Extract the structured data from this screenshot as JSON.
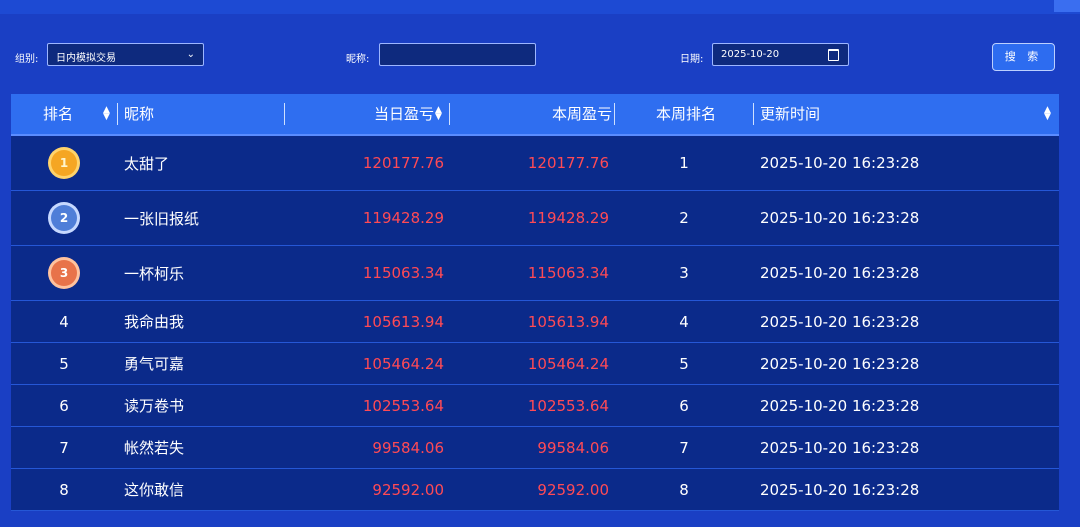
{
  "filters": {
    "group_label": "组别:",
    "group_value": "日内模拟交易",
    "nickname_label": "昵称:",
    "nickname_value": "",
    "date_label": "日期:",
    "date_value": "2025-10-20",
    "search_label": "搜 索"
  },
  "table": {
    "headers": {
      "rank": "排名",
      "name": "昵称",
      "day_pnl": "当日盈亏",
      "week_pnl": "本周盈亏",
      "week_rank": "本周排名",
      "updated": "更新时间"
    },
    "rows": [
      {
        "rank": "1",
        "name": "太甜了",
        "day_pnl": "120177.76",
        "week_pnl": "120177.76",
        "week_rank": "1",
        "updated": "2025-10-20 16:23:28"
      },
      {
        "rank": "2",
        "name": "一张旧报纸",
        "day_pnl": "119428.29",
        "week_pnl": "119428.29",
        "week_rank": "2",
        "updated": "2025-10-20 16:23:28"
      },
      {
        "rank": "3",
        "name": "一杯柯乐",
        "day_pnl": "115063.34",
        "week_pnl": "115063.34",
        "week_rank": "3",
        "updated": "2025-10-20 16:23:28"
      },
      {
        "rank": "4",
        "name": "我命由我",
        "day_pnl": "105613.94",
        "week_pnl": "105613.94",
        "week_rank": "4",
        "updated": "2025-10-20 16:23:28"
      },
      {
        "rank": "5",
        "name": "勇气可嘉",
        "day_pnl": "105464.24",
        "week_pnl": "105464.24",
        "week_rank": "5",
        "updated": "2025-10-20 16:23:28"
      },
      {
        "rank": "6",
        "name": "读万卷书",
        "day_pnl": "102553.64",
        "week_pnl": "102553.64",
        "week_rank": "6",
        "updated": "2025-10-20 16:23:28"
      },
      {
        "rank": "7",
        "name": "帐然若失",
        "day_pnl": "99584.06",
        "week_pnl": "99584.06",
        "week_rank": "7",
        "updated": "2025-10-20 16:23:28"
      },
      {
        "rank": "8",
        "name": "这你敢信",
        "day_pnl": "92592.00",
        "week_pnl": "92592.00",
        "week_rank": "8",
        "updated": "2025-10-20 16:23:28"
      }
    ]
  },
  "colors": {
    "background": "#1a3fc4",
    "header": "#2f6ef0",
    "row": "#0b2a8a",
    "pnl": "#ff4a55"
  }
}
